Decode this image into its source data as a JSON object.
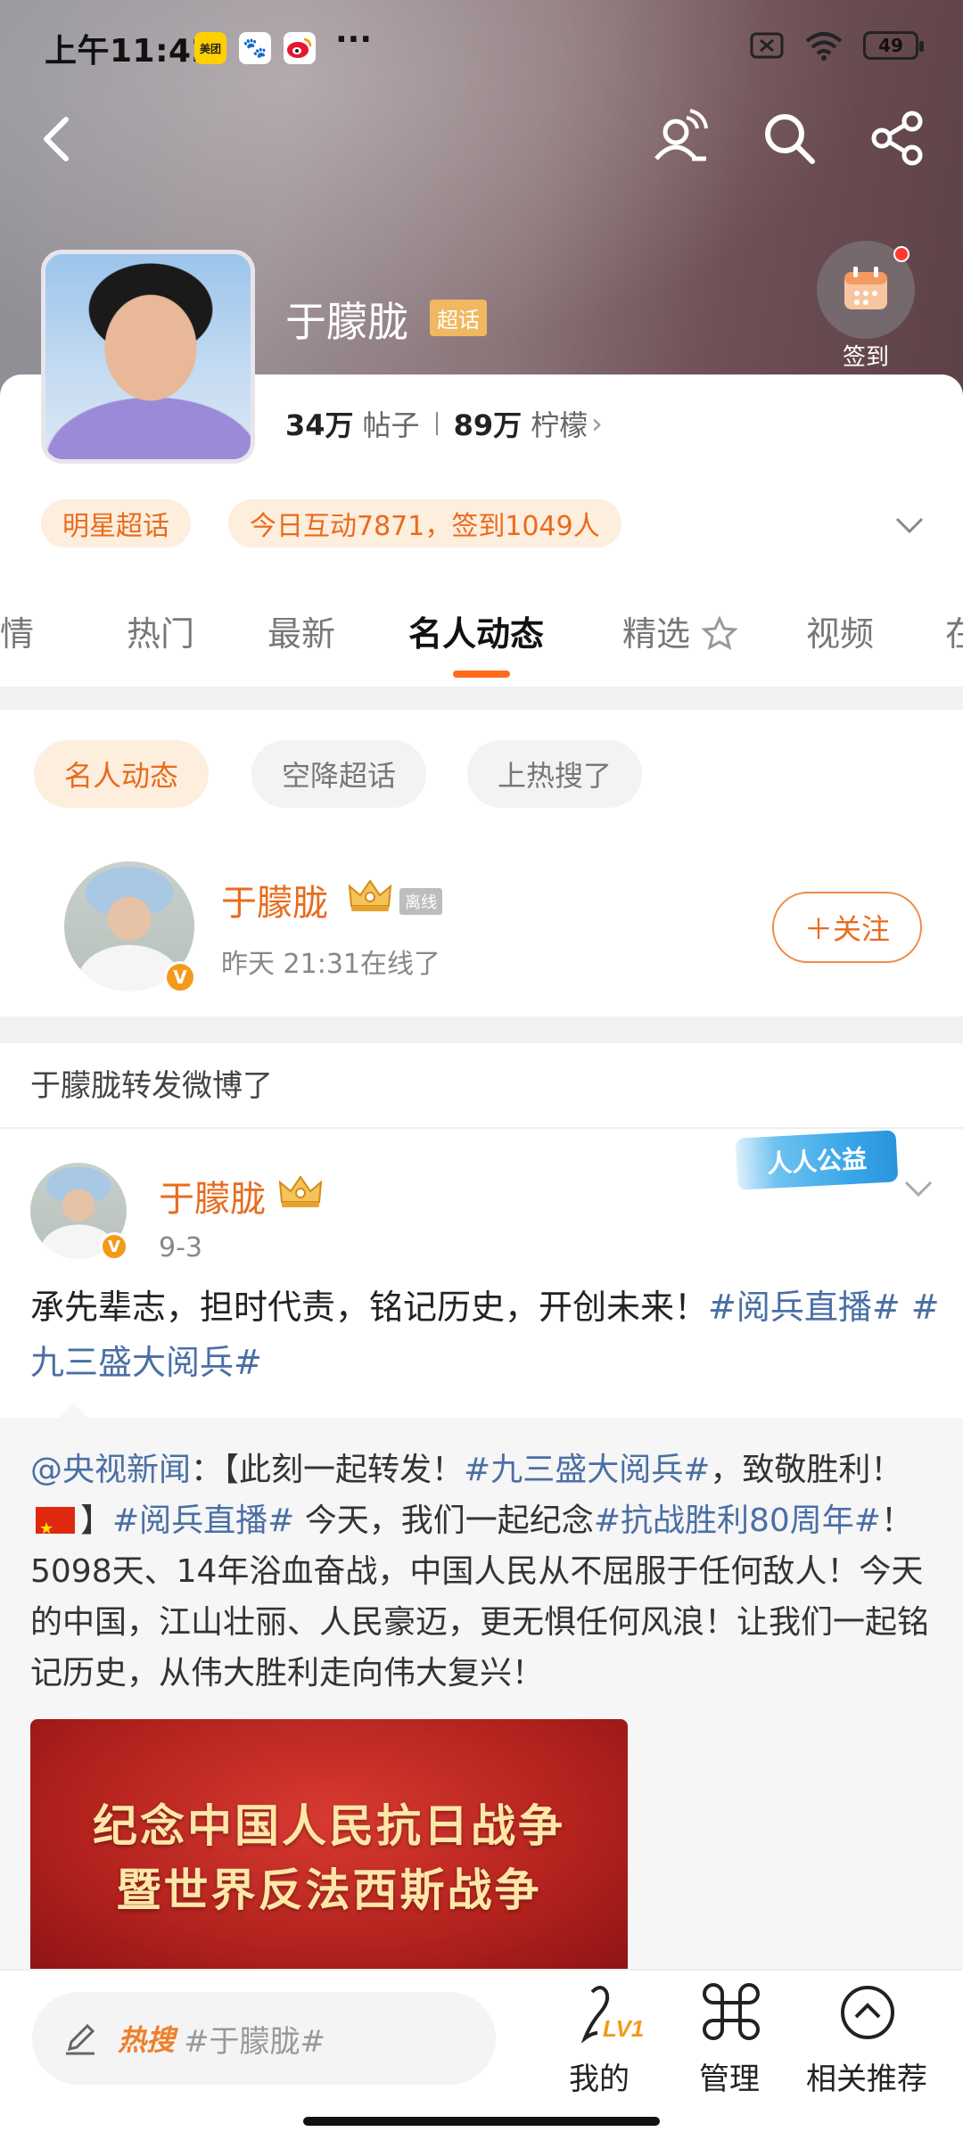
{
  "status_bar": {
    "time": "上午11:42",
    "app_icons": [
      "美团",
      "百度",
      "微博"
    ],
    "more": "···",
    "battery": "49"
  },
  "profile": {
    "name": "于朦胧",
    "badge": "超话",
    "checkin_label": "签到",
    "posts_count": "34万",
    "posts_label": "帖子",
    "followers_count": "89万",
    "followers_label": "柠檬",
    "arrow": "›",
    "tags": [
      "明星超话",
      "今日互动7871，签到1049人"
    ]
  },
  "tabs": {
    "items": [
      "详情",
      "热门",
      "最新",
      "名人动态",
      "精选",
      "视频",
      "在"
    ],
    "active": "名人动态"
  },
  "filter_chips": [
    "名人动态",
    "空降超话",
    "上热搜了"
  ],
  "celebrity": {
    "name": "于朦胧",
    "offline_tag": "离线",
    "status": "昨天 21:31在线了",
    "follow_label": "＋关注",
    "v_badge": "V"
  },
  "post": {
    "repost_header": "于朦胧转发微博了",
    "author": "于朦胧",
    "date": "9-3",
    "charity_badge": "人人公益",
    "text_plain": "承先辈志，担时代责，铭记历史，开创未来！",
    "hashtag1": "#阅兵直播#",
    "hashtag2": "#九三盛大阅兵#",
    "retweet": {
      "mention": "@央视新闻",
      "part1": "：【此刻一起转发！",
      "hashtag1": "#九三盛大阅兵#",
      "part2": "，致敬胜利！",
      "part3": "】",
      "hashtag2": "#阅兵直播#",
      "part4": " 今天，我们一起纪念",
      "hashtag3": "#抗战胜利80周年#",
      "part5": "！5098天、14年浴血奋战，中国人民从不屈服于任何敌人！今天的中国，江山壮丽、人民豪迈，更无惧任何风浪！让我们一起铭记历史，从伟大胜利走向伟大复兴！",
      "image_line1": "纪念中国人民抗日战争",
      "image_line2": "暨世界反法西斯战争"
    }
  },
  "bottom_bar": {
    "hot_label": "热搜",
    "hot_text": "#于朦胧#",
    "level": "LV1",
    "mine_label": "我的",
    "manage_label": "管理",
    "recommend_label": "相关推荐"
  }
}
